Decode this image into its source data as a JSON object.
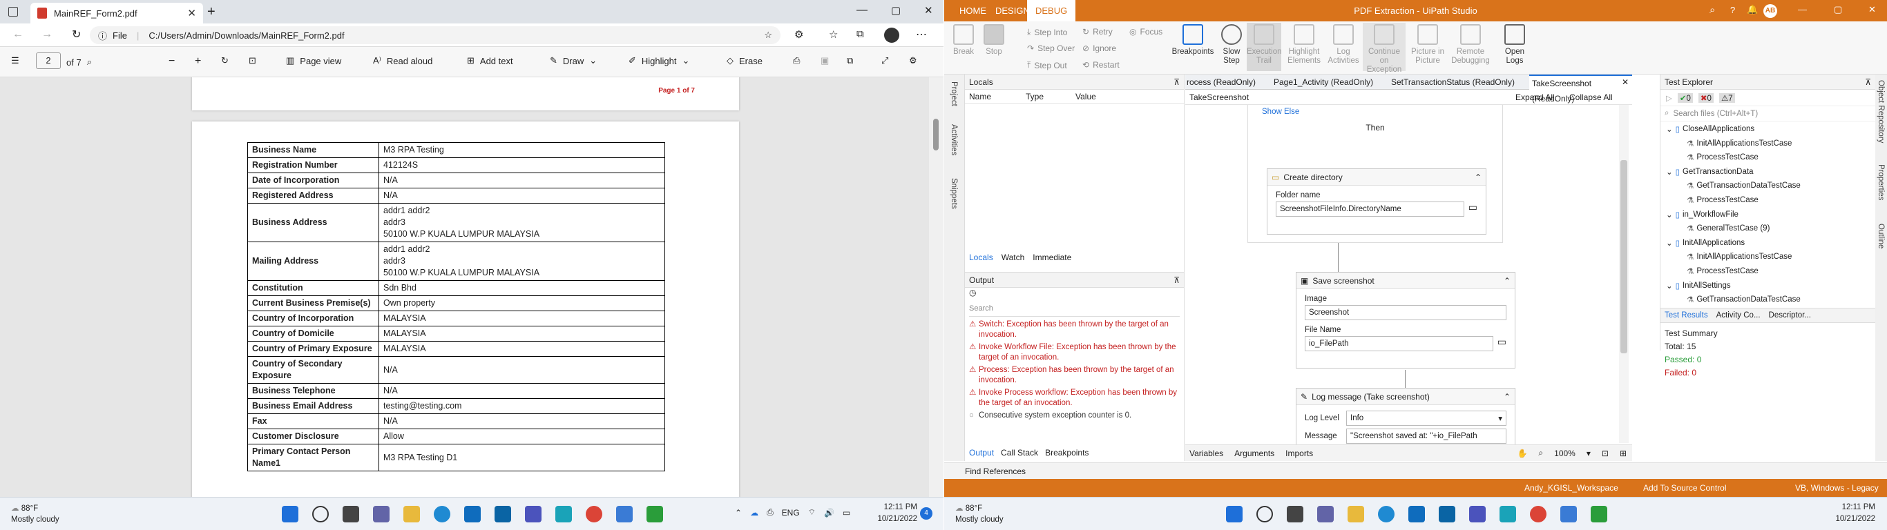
{
  "edge": {
    "tab_title": "MainREF_Form2.pdf",
    "address_label": "File",
    "address_url": "C:/Users/Admin/Downloads/MainREF_Form2.pdf",
    "page_current": "2",
    "page_total": "of 7",
    "toolbar": {
      "page_view": "Page view",
      "read_aloud": "Read aloud",
      "add_text": "Add text",
      "draw": "Draw",
      "highlight": "Highlight",
      "erase": "Erase"
    },
    "page_footer": "Page 1 of 7",
    "table": [
      {
        "k": "Business Name",
        "v": [
          "M3 RPA Testing"
        ]
      },
      {
        "k": "Registration Number",
        "v": [
          "412124S"
        ]
      },
      {
        "k": "Date of Incorporation",
        "v": [
          "N/A"
        ]
      },
      {
        "k": "Registered Address",
        "v": [
          "N/A"
        ]
      },
      {
        "k": "Business Address",
        "v": [
          "addr1 addr2",
          "addr3",
          "50100 W.P KUALA LUMPUR MALAYSIA"
        ]
      },
      {
        "k": "Mailing Address",
        "v": [
          "addr1 addr2",
          "addr3",
          "50100 W.P KUALA LUMPUR MALAYSIA"
        ]
      },
      {
        "k": "Constitution",
        "v": [
          "Sdn Bhd"
        ]
      },
      {
        "k": "Current Business Premise(s)",
        "v": [
          "Own property"
        ]
      },
      {
        "k": "Country of Incorporation",
        "v": [
          "MALAYSIA"
        ]
      },
      {
        "k": "Country of Domicile",
        "v": [
          "MALAYSIA"
        ]
      },
      {
        "k": "Country of Primary Exposure",
        "v": [
          "MALAYSIA"
        ]
      },
      {
        "k": "Country of Secondary Exposure",
        "v": [
          "N/A"
        ]
      },
      {
        "k": "Business Telephone",
        "v": [
          "N/A"
        ]
      },
      {
        "k": "Business Email Address",
        "v": [
          "testing@testing.com"
        ]
      },
      {
        "k": "Fax",
        "v": [
          "N/A"
        ]
      },
      {
        "k": "Customer Disclosure",
        "v": [
          "Allow"
        ]
      },
      {
        "k": "Primary Contact Person Name1",
        "v": [
          "M3 RPA Testing D1"
        ]
      }
    ]
  },
  "uipath": {
    "tabs": [
      "HOME",
      "DESIGN",
      "DEBUG"
    ],
    "title": "PDF Extraction - UiPath Studio",
    "avatar": "AB",
    "ribbon": {
      "break": "Break",
      "stop": "Stop",
      "step_into": "Step Into",
      "step_over": "Step Over",
      "step_out": "Step Out",
      "retry": "Retry",
      "ignore": "Ignore",
      "restart": "Restart",
      "focus": "Focus",
      "breakpoints": "Breakpoints",
      "slow_step": "Slow Step",
      "execution_trail": "Execution Trail",
      "highlight_elements": "Highlight Elements",
      "log_activities": "Log Activities",
      "continue_on_exception": "Continue on Exception",
      "picture_in_picture": "Picture in Picture",
      "remote_debugging": "Remote Debugging",
      "open_logs": "Open Logs"
    },
    "side_left": [
      "Project",
      "Activities",
      "Snippets"
    ],
    "locals": {
      "title": "Locals",
      "cols": [
        "Name",
        "Type",
        "Value"
      ],
      "tabs": [
        "Locals",
        "Watch",
        "Immediate"
      ]
    },
    "output": {
      "title": "Output",
      "search_placeholder": "Search",
      "lines": [
        "Switch: Exception has been thrown by the target of an invocation.",
        "Invoke Workflow File: Exception has been thrown by the target of an invocation.",
        "Process: Exception has been thrown by the target of an invocation.",
        "Invoke Process workflow: Exception has been thrown by the target of an invocation."
      ],
      "info_line": "Consecutive system exception counter is 0.",
      "tabs": [
        "Output",
        "Call Stack",
        "Breakpoints"
      ]
    },
    "designer": {
      "tabs": [
        "rocess (ReadOnly)",
        "Page1_Activity (ReadOnly)",
        "SetTransactionStatus (ReadOnly)",
        "TakeScreenshot (ReadOnly)"
      ],
      "breadcrumb": "TakeScreenshot",
      "expand_all": "Expand All",
      "collapse_all": "Collapse All",
      "show_else": "Show Else",
      "then": "Then",
      "create_directory": {
        "title": "Create directory",
        "label": "Folder name",
        "value": "ScreenshotFileInfo.DirectoryName"
      },
      "save_screenshot": {
        "title": "Save screenshot",
        "image_label": "Image",
        "image_value": "Screenshot",
        "file_label": "File Name",
        "file_value": "io_FilePath"
      },
      "log_message": {
        "title": "Log message (Take screenshot)",
        "level_label": "Log Level",
        "level_value": "Info",
        "message_label": "Message",
        "message_value": "\"Screenshot saved at: \"+io_FilePath"
      },
      "bottom_tabs": [
        "Variables",
        "Arguments",
        "Imports"
      ],
      "zoom": "100%"
    },
    "test_explorer": {
      "title": "Test Explorer",
      "counts": [
        "0",
        "0",
        "7"
      ],
      "search_placeholder": "Search files (Ctrl+Alt+T)",
      "tree": [
        {
          "label": "CloseAllApplications",
          "level": 0
        },
        {
          "label": "InitAllApplicationsTestCase",
          "level": 1
        },
        {
          "label": "ProcessTestCase",
          "level": 1
        },
        {
          "label": "GetTransactionData",
          "level": 0
        },
        {
          "label": "GetTransactionDataTestCase",
          "level": 1
        },
        {
          "label": "ProcessTestCase",
          "level": 1
        },
        {
          "label": "in_WorkflowFile",
          "level": 0
        },
        {
          "label": "GeneralTestCase (9)",
          "level": 1
        },
        {
          "label": "InitAllApplications",
          "level": 0
        },
        {
          "label": "InitAllApplicationsTestCase",
          "level": 1
        },
        {
          "label": "ProcessTestCase",
          "level": 1
        },
        {
          "label": "InitAllSettings",
          "level": 0
        },
        {
          "label": "GetTransactionDataTestCase",
          "level": 1
        }
      ],
      "bottom_tabs": [
        "Test Results",
        "Activity Co...",
        "Descriptor..."
      ],
      "summary_title": "Test Summary",
      "total": "Total: 15",
      "passed": "Passed: 0",
      "failed": "Failed: 0"
    },
    "side_right": [
      "Object Repository",
      "Properties",
      "Outline"
    ],
    "find_references": "Find References",
    "status": {
      "workspace": "Andy_KGISL_Workspace",
      "source_control": "Add To Source Control",
      "runtime": "VB, Windows - Legacy"
    }
  },
  "taskbar": {
    "weather_temp": "88°F",
    "weather_desc": "Mostly cloudy",
    "lang": "ENG",
    "time": "12:11 PM",
    "date": "10/21/2022",
    "notif": "4"
  },
  "colors": {
    "uipath_orange": "#d9731b",
    "error_red": "#c42020"
  }
}
